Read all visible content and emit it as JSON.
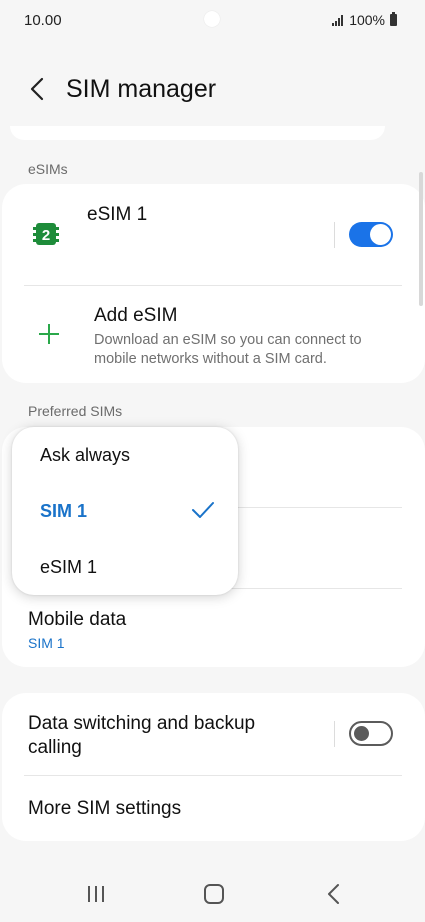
{
  "status_bar": {
    "time": "10.00",
    "battery": "100%"
  },
  "header": {
    "title": "SIM manager"
  },
  "esims": {
    "section_label": "eSIMs",
    "esim1": {
      "label": "eSIM 1",
      "badge": "2",
      "toggle_on": true
    },
    "add": {
      "title": "Add eSIM",
      "description_line1": "Download an eSIM so you can connect to",
      "description_line2": "mobile networks without a SIM card."
    }
  },
  "preferred": {
    "section_label": "Preferred SIMs",
    "mobile_data": {
      "title": "Mobile data",
      "value": "SIM 1"
    }
  },
  "popup": {
    "options": [
      "Ask always",
      "SIM 1",
      "eSIM 1"
    ],
    "selected": "SIM 1"
  },
  "settings": {
    "data_switching": {
      "title_line1": "Data switching and backup",
      "title_line2": "calling",
      "toggle_on": false
    },
    "more": {
      "title": "More SIM settings"
    }
  },
  "colors": {
    "accent": "#1a73e8",
    "badge_green": "#1e8c3a",
    "plus_green": "#2aa84a"
  },
  "icons": [
    "back-icon",
    "esim-card-icon",
    "plus-icon",
    "check-icon",
    "recents-icon",
    "home-icon",
    "nav-back-icon"
  ]
}
